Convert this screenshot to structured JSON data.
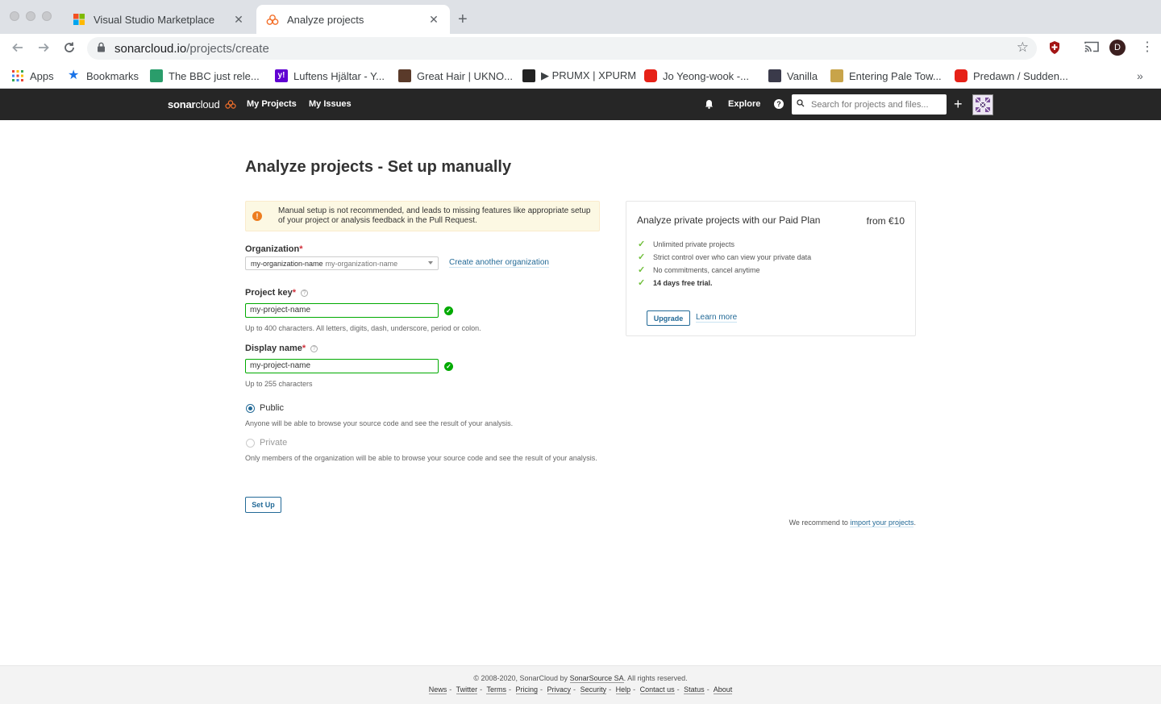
{
  "browser": {
    "tabs": [
      {
        "title": "Visual Studio Marketplace",
        "favicon": "microsoft-logo"
      },
      {
        "title": "Analyze projects",
        "favicon": "sonarcloud-logo"
      }
    ],
    "url_host": "sonarcloud.io",
    "url_path": "/projects/create",
    "profile_initial": "D",
    "bookmarks": [
      {
        "label": "Apps",
        "icon": "apps-grid-icon",
        "color": "#4285f4"
      },
      {
        "label": "Bookmarks",
        "icon": "star-icon",
        "color": "#1a73e8"
      },
      {
        "label": "The BBC just rele...",
        "icon": "bbc-favicon",
        "color": "#2a9d6b"
      },
      {
        "label": "Luftens Hjältar - Y...",
        "icon": "yahoo-favicon",
        "color": "#6001d2"
      },
      {
        "label": "Great Hair | UKNO...",
        "icon": "site-favicon",
        "color": "#5a3a2a"
      },
      {
        "label": "▶ PRUMX | XPURM",
        "icon": "site-favicon",
        "color": "#222222"
      },
      {
        "label": "Jo Yeong-wook -...",
        "icon": "youtube-favicon",
        "color": "#e62117"
      },
      {
        "label": "Vanilla",
        "icon": "site-favicon",
        "color": "#3a3a4a"
      },
      {
        "label": "Entering Pale Tow...",
        "icon": "site-favicon",
        "color": "#c8a44a"
      },
      {
        "label": "Predawn / Sudden...",
        "icon": "youtube-favicon",
        "color": "#e62117"
      }
    ]
  },
  "sonar_nav": {
    "logo_bold": "sonar",
    "logo_light": "cloud",
    "my_projects": "My Projects",
    "my_issues": "My Issues",
    "explore": "Explore",
    "search_placeholder": "Search for projects and files..."
  },
  "page": {
    "title_strong": "Analyze projects",
    "title_rest": " - Set up manually",
    "warning": "Manual setup is not recommended, and leads to missing features like appropriate setup of your project or analysis feedback in the Pull Request.",
    "organization_label": "Organization",
    "organization_value": "my-organization-name",
    "organization_sub": "my-organization-name",
    "create_org_link": "Create another organization",
    "project_key_label": "Project key",
    "project_key_value": "my-project-name",
    "project_key_hint": "Up to 400 characters. All letters, digits, dash, underscore, period or colon.",
    "display_name_label": "Display name",
    "display_name_value": "my-project-name",
    "display_name_hint": "Up to 255 characters",
    "public_label": "Public",
    "public_hint": "Anyone will be able to browse your source code and see the result of your analysis.",
    "private_label": "Private",
    "private_hint": "Only members of the organization will be able to browse your source code and see the result of your analysis.",
    "setup_button": "Set Up",
    "recommend_text": "We recommend to ",
    "recommend_link": "import your projects",
    "recommend_end": "."
  },
  "plan": {
    "title": "Analyze private projects with our Paid Plan",
    "price": "from €10",
    "features": [
      "Unlimited private projects",
      "Strict control over who can view your private data",
      "No commitments, cancel anytime",
      "14 days free trial."
    ],
    "upgrade_button": "Upgrade",
    "learn_more": "Learn more"
  },
  "footer": {
    "copyright_prefix": "© 2008-2020, SonarCloud by ",
    "company": "SonarSource SA",
    "copyright_suffix": ". All rights reserved.",
    "links": [
      "News",
      "Twitter",
      "Terms",
      "Pricing",
      "Privacy",
      "Security",
      "Help",
      "Contact us",
      "Status",
      "About"
    ]
  },
  "colors": {
    "accent": "#236a97",
    "valid": "#00aa00",
    "warning_bg": "#fcf8e3",
    "nav_bg": "#262626",
    "sonar_orange": "#f3702a"
  }
}
